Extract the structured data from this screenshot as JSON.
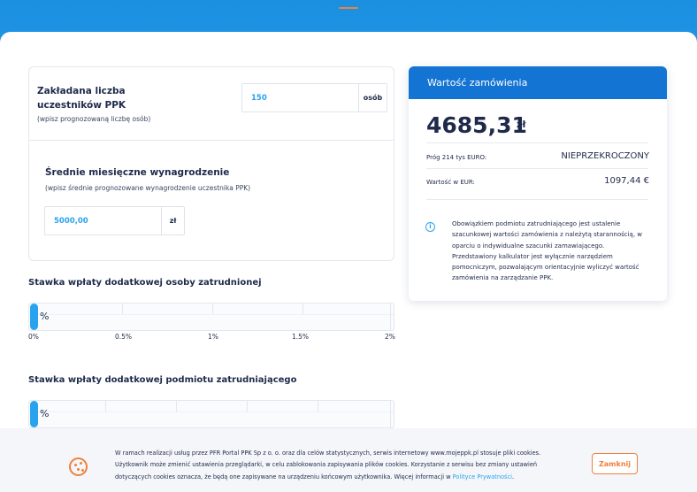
{
  "participants": {
    "title_line1": "Zakładana liczba",
    "title_line2": "uczestników PPK",
    "hint": "(wpisz prognozowaną liczbę osób)",
    "value": "150",
    "unit": "osób"
  },
  "salary": {
    "title": "Średnie miesięczne wynagrodzenie",
    "hint": "(wpisz średnie prognozowane wynagrodzenie uczestnika PPK)",
    "value": "5000,00",
    "unit": "zł"
  },
  "employee_rate": {
    "title": "Stawka wpłaty dodatkowej osoby zatrudnionej",
    "pct_symbol": "%",
    "value_percent": 0,
    "ticks": [
      "0%",
      "0.5%",
      "1%",
      "1.5%",
      "2%"
    ]
  },
  "employer_rate": {
    "title": "Stawka wpłaty dodatkowej podmiotu zatrudniającego",
    "pct_symbol": "%",
    "value_percent": 0
  },
  "summary": {
    "header": "Wartość zamówienia",
    "amount": "4685,31",
    "currency": "zł",
    "threshold_label": "Próg 214 tys EURO:",
    "threshold_value": "NIEPRZEKROCZONY",
    "eur_label": "Wartość w EUR:",
    "eur_value": "1097,44 €",
    "info_icon": "info-circle-icon",
    "info_line1": "Obowiązkiem podmiotu zatrudniającego jest ustalenie",
    "info_line2": "szacunkowej wartości zamówienia z należytą starannością, w",
    "info_line3": "oparciu o indywidualne szacunki zamawiającego.",
    "info_line4": "Przedstawiony kalkulator jest wyłącznie narzędziem",
    "info_line5": "pomocniczym, pozwalającym orientacyjnie wyliczyć wartość",
    "info_line6": "zamówienia na zarządzanie PPK."
  },
  "cookies": {
    "icon": "cookie-icon",
    "line1": "W ramach realizacji usług przez PFR Portal PPK Sp z o. o. oraz dla celów statystycznych, serwis internetowy www.mojeppk.pl stosuje pliki cookies.",
    "line2": "Użytkownik może zmienić ustawienia przeglądarki, w celu zablokowania zapisywania plików cookies. Korzystanie z serwisu bez zmiany ustawień",
    "line3": "dotyczących cookies oznacza, że będą one zapisywane na urządzeniu końcowym użytkownika. Więcej informacji w ",
    "link": "Polityce Prywatności",
    "line3_end": ".",
    "close_label": "Zamknij"
  },
  "colors": {
    "primary_blue": "#1474d4",
    "accent_blue": "#2aa3ee",
    "accent_orange": "#f0813a"
  }
}
